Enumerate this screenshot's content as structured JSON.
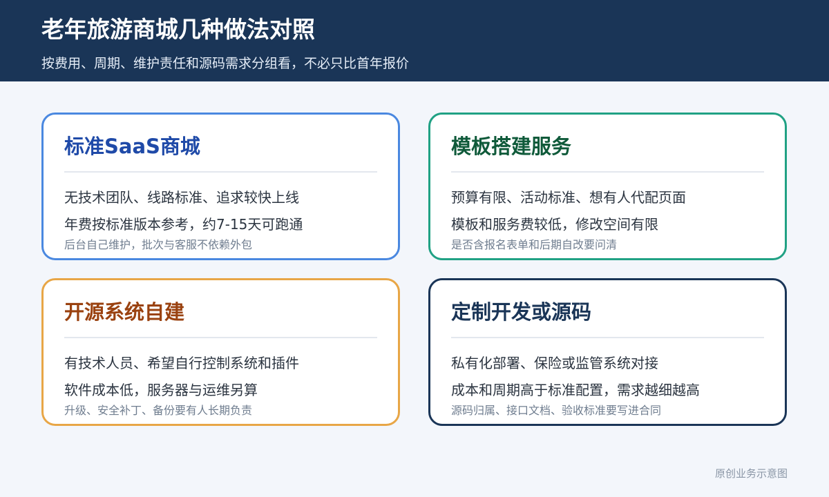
{
  "header": {
    "title": "老年旅游商城几种做法对照",
    "subtitle": "按费用、周期、维护责任和源码需求分组看，不必只比首年报价"
  },
  "cards": [
    {
      "title": "标准SaaS商城",
      "line1": "无技术团队、线路标准、追求较快上线",
      "line2": "年费按标准版本参考，约7-15天可跑通",
      "note": "后台自己维护，批次与客服不依赖外包",
      "accent": "#4a88e0"
    },
    {
      "title": "模板搭建服务",
      "line1": "预算有限、活动标准、想有人代配页面",
      "line2": "模板和服务费较低，修改空间有限",
      "note": "是否含报名表单和后期自改要问清",
      "accent": "#20a184"
    },
    {
      "title": "开源系统自建",
      "line1": "有技术人员、希望自行控制系统和插件",
      "line2": "软件成本低，服务器与运维另算",
      "note": "升级、安全补丁、备份要有人长期负责",
      "accent": "#e8a646"
    },
    {
      "title": "定制开发或源码",
      "line1": "私有化部署、保险或监管系统对接",
      "line2": "成本和周期高于标准配置，需求越细越高",
      "note": "源码归属、接口文档、验收标准要写进合同",
      "accent": "#1a3557"
    }
  ],
  "footer": {
    "note": "原创业务示意图"
  }
}
